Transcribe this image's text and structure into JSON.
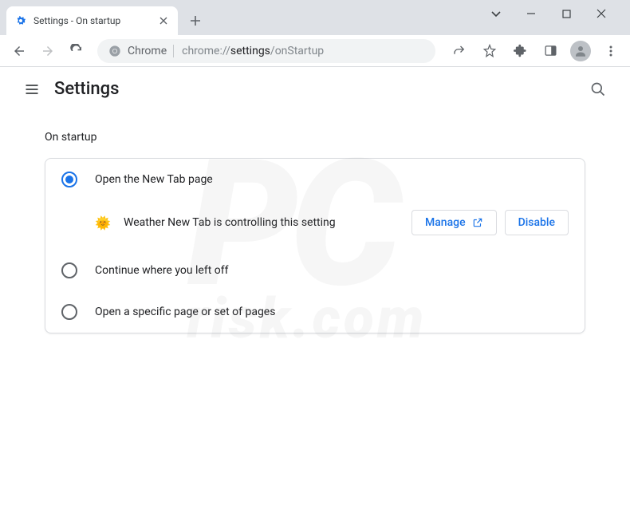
{
  "window": {
    "tab_title": "Settings - On startup"
  },
  "toolbar": {
    "chrome_label": "Chrome",
    "url_prefix": "chrome://",
    "url_strong": "settings",
    "url_suffix": "/onStartup"
  },
  "header": {
    "title": "Settings"
  },
  "section": {
    "title": "On startup",
    "options": [
      {
        "label": "Open the New Tab page",
        "selected": true
      },
      {
        "label": "Continue where you left off",
        "selected": false
      },
      {
        "label": "Open a specific page or set of pages",
        "selected": false
      }
    ],
    "extension": {
      "name": "Weather New Tab is controlling this setting",
      "manage_label": "Manage",
      "disable_label": "Disable"
    }
  },
  "watermark": {
    "main": "PC",
    "sub": "risk.com"
  }
}
